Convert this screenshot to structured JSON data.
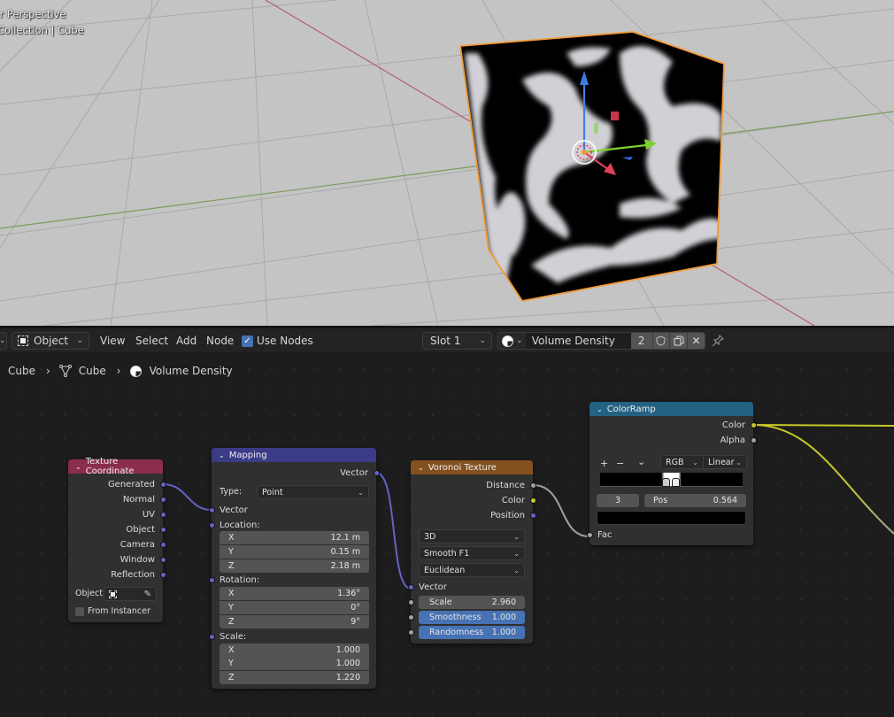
{
  "viewport": {
    "view_label": "User Perspective",
    "collection_label": "Collection | Cube",
    "colors": {
      "background": "#c4c4c4",
      "grid": "#a8a8a8",
      "x_axis": "#b0606a",
      "y_axis": "#7a9a5a",
      "selection_outline": "#f29a37"
    }
  },
  "header": {
    "mode_label": "Object",
    "menu": [
      "View",
      "Select",
      "Add",
      "Node"
    ],
    "use_nodes_label": "Use Nodes",
    "use_nodes_checked": true,
    "slot_label": "Slot 1",
    "material_name": "Volume Density",
    "user_count": "2",
    "icons": [
      "material-sphere-icon",
      "fake-user-shield-icon",
      "duplicate-icon",
      "close-icon",
      "pin-icon"
    ]
  },
  "breadcrumb": [
    "Cube",
    "Cube",
    "Volume Density"
  ],
  "nodes": {
    "texture_coordinate": {
      "title": "Texture Coordinate",
      "color": "#8a2d4e",
      "outputs": [
        "Generated",
        "Normal",
        "UV",
        "Object",
        "Camera",
        "Window",
        "Reflection"
      ],
      "object_label": "Object:",
      "from_instancer_label": "From Instancer",
      "from_instancer_checked": false
    },
    "mapping": {
      "title": "Mapping",
      "color": "#3b3b87",
      "output": "Vector",
      "type_label": "Type:",
      "type_value": "Point",
      "vector_input": "Vector",
      "location_label": "Location:",
      "location": [
        {
          "axis": "X",
          "value": "12.1 m"
        },
        {
          "axis": "Y",
          "value": "0.15 m"
        },
        {
          "axis": "Z",
          "value": "2.18 m"
        }
      ],
      "rotation_label": "Rotation:",
      "rotation": [
        {
          "axis": "X",
          "value": "1.36°"
        },
        {
          "axis": "Y",
          "value": "0°"
        },
        {
          "axis": "Z",
          "value": "9°"
        }
      ],
      "scale_label": "Scale:",
      "scale": [
        {
          "axis": "X",
          "value": "1.000"
        },
        {
          "axis": "Y",
          "value": "1.000"
        },
        {
          "axis": "Z",
          "value": "1.220"
        }
      ]
    },
    "voronoi": {
      "title": "Voronoi Texture",
      "color": "#83501f",
      "outputs": [
        "Distance",
        "Color",
        "Position"
      ],
      "dimensions": "3D",
      "feature": "Smooth F1",
      "metric": "Euclidean",
      "vector_input": "Vector",
      "scale_label": "Scale",
      "scale_value": "2.960",
      "smoothness_label": "Smoothness",
      "smoothness_value": "1.000",
      "randomness_label": "Randomness",
      "randomness_value": "1.000"
    },
    "colorramp": {
      "title": "ColorRamp",
      "color": "#246283",
      "outputs": [
        "Color",
        "Alpha"
      ],
      "add_label": "+",
      "remove_label": "−",
      "menu_label": "⌄",
      "color_mode": "RGB",
      "interpolation": "Linear",
      "active_index": "3",
      "pos_label": "Pos",
      "pos_value": "0.564",
      "input": "Fac"
    }
  }
}
